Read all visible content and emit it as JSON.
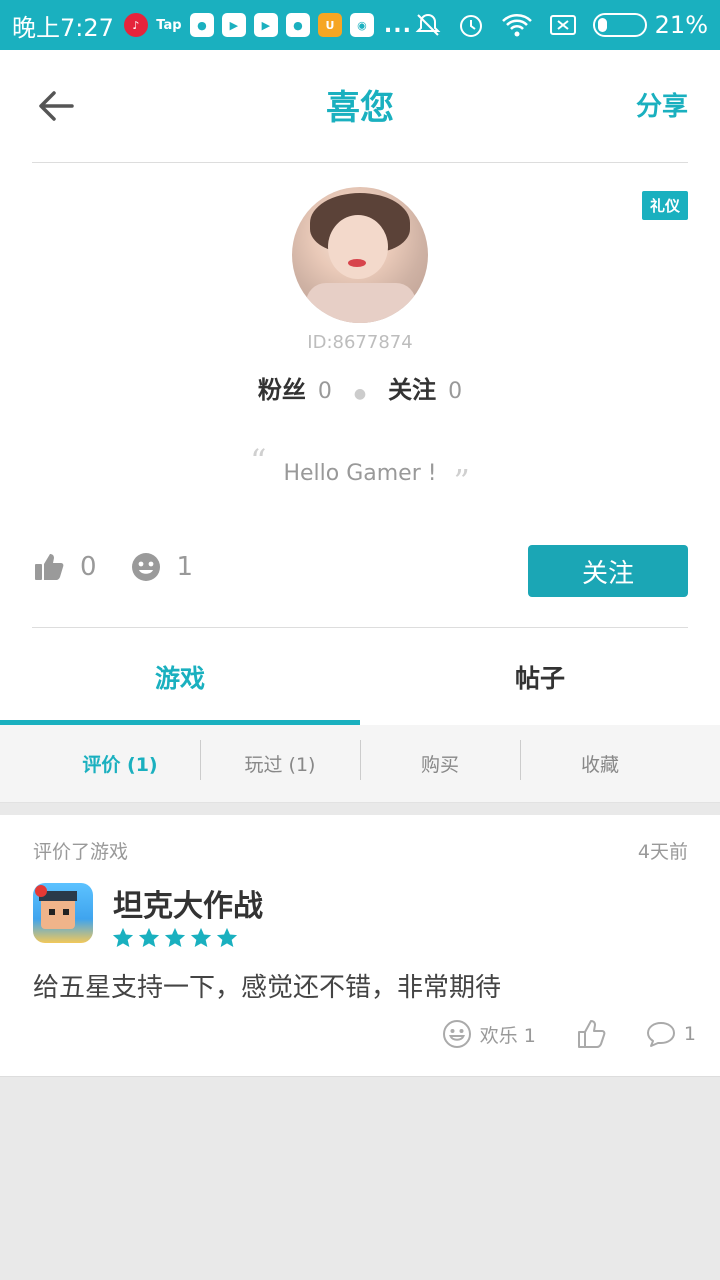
{
  "status_bar": {
    "time": "晚上7:27",
    "battery_percent_label": "21%",
    "battery_level": 0.21,
    "notification_icons": [
      "netease-music-icon",
      "taptap-icon",
      "app-icon",
      "play-store-icon",
      "play-store-icon",
      "app-icon",
      "uc-browser-icon",
      "video-icon"
    ],
    "tap_label": "Tap",
    "more_label": "..."
  },
  "header": {
    "title": "喜您",
    "share_label": "分享"
  },
  "profile": {
    "badge": "礼仪",
    "user_id": "ID:8677874",
    "fans_label": "粉丝",
    "fans_count": "0",
    "following_label": "关注",
    "following_count": "0",
    "bio": "Hello Gamer !",
    "quote_open": "“",
    "quote_close": "”",
    "likes_count": "0",
    "fun_count": "1",
    "follow_button": "关注"
  },
  "tabs": [
    {
      "label": "游戏",
      "active": true
    },
    {
      "label": "帖子",
      "active": false
    }
  ],
  "subtabs": [
    {
      "label": "评价 (1)",
      "active": true
    },
    {
      "label": "玩过 (1)",
      "active": false
    },
    {
      "label": "购买",
      "active": false
    },
    {
      "label": "收藏",
      "active": false
    }
  ],
  "review": {
    "meta": "评价了游戏",
    "time": "4天前",
    "game_name": "坦克大作战",
    "rating": 5,
    "text": "给五星支持一下，感觉还不错，非常期待",
    "fun_label": "欢乐 1",
    "comment_count": "1"
  },
  "colors": {
    "accent": "#1ab0bf",
    "button": "#1ba6b5",
    "muted": "#999999"
  }
}
